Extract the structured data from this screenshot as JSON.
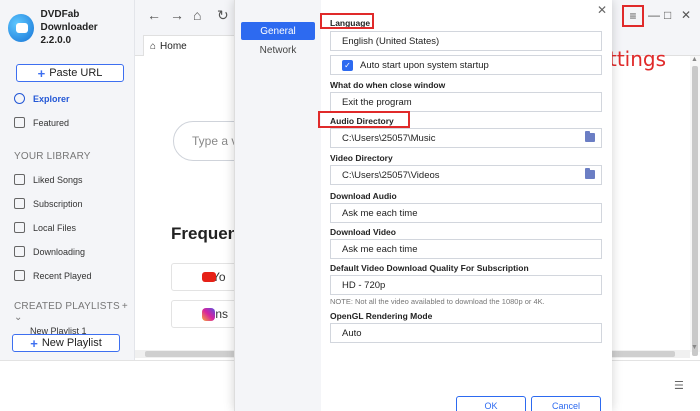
{
  "app": {
    "name": "DVDFab Downloader",
    "version": "2.2.0.0"
  },
  "sidebar": {
    "paste_url": "Paste URL",
    "nav": [
      {
        "label": "Explorer",
        "icon": "globe-icon"
      },
      {
        "label": "Featured",
        "icon": "star-icon"
      }
    ],
    "library_title": "YOUR LIBRARY",
    "library": [
      {
        "label": "Liked Songs",
        "icon": "heart-icon"
      },
      {
        "label": "Subscription",
        "icon": "rss-icon"
      },
      {
        "label": "Local Files",
        "icon": "folder-icon"
      },
      {
        "label": "Downloading",
        "icon": "download-icon"
      },
      {
        "label": "Recent Played",
        "icon": "clock-icon"
      }
    ],
    "playlists_title": "CREATED PLAYLISTS",
    "playlist_item": "New Playlist 1",
    "new_playlist": "New Playlist"
  },
  "browser": {
    "tab_home": "Home",
    "search_placeholder": "Type a v",
    "frequent": "Frequen",
    "sites": [
      {
        "label": "Yo",
        "icon": "youtube-icon"
      },
      {
        "label": "Ins",
        "icon": "instagram-icon"
      }
    ]
  },
  "annotation": {
    "settings": "Settings"
  },
  "dialog": {
    "tabs": [
      "General",
      "Network"
    ],
    "language_label": "Language",
    "language_value": "English (United States)",
    "autostart_label": "Auto start upon system startup",
    "close_label": "What do when close window",
    "close_value": "Exit the program",
    "audio_dir_label": "Audio Directory",
    "audio_dir_value": "C:\\Users\\25057\\Music",
    "video_dir_label": "Video Directory",
    "video_dir_value": "C:\\Users\\25057\\Videos",
    "dl_audio_label": "Download Audio",
    "dl_audio_value": "Ask me each time",
    "dl_video_label": "Download Video",
    "dl_video_value": "Ask me each time",
    "quality_label": "Default Video Download Quality For Subscription",
    "quality_value": "HD - 720p",
    "quality_note": "NOTE: Not all the video availabled to download the 1080p or 4K.",
    "opengl_label": "OpenGL Rendering Mode",
    "opengl_value": "Auto",
    "ok": "OK",
    "cancel": "Cancel"
  },
  "colors": {
    "accent": "#2d6af0",
    "annotation": "#e02a2a"
  }
}
